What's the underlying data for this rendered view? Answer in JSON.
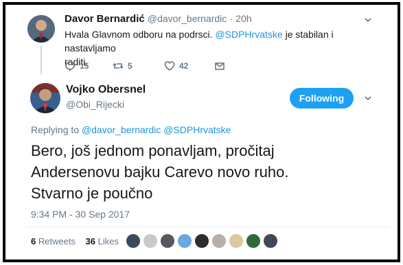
{
  "reply_to_tweet": {
    "display_name": "Davor Bernardić",
    "handle": "@davor_bernardic",
    "separator": "·",
    "time": "20h",
    "text_before": "Hvala Glavnom odboru na podrsci. ",
    "mention": "@SDPHrvatske",
    "text_after": " je stabilan i nastavljamo",
    "text_line2": "raditi.",
    "replies": "15",
    "retweets": "5",
    "likes": "42"
  },
  "main_tweet": {
    "display_name": "Vojko Obersnel",
    "handle": "@Obi_Rijecki",
    "follow_label": "Following",
    "replying_prefix": "Replying to ",
    "replying_to_1": "@davor_bernardic",
    "replying_to_2": "@SDPHrvatske",
    "text_line1": "Bero, još jednom ponavljam, pročitaj",
    "text_line2": "Andersenovu bajku Carevo novo ruho.",
    "text_line3": "Stvarno je poučno",
    "timestamp": "9:34 PM - 30 Sep 2017",
    "retweet_count": "6",
    "retweet_label": "Retweets",
    "like_count": "36",
    "like_label": "Likes"
  },
  "likers": [
    {
      "name": "liker-avatar-1",
      "color": "#3b4a5a"
    },
    {
      "name": "liker-avatar-2",
      "color": "#c9c9c9"
    },
    {
      "name": "liker-avatar-3",
      "color": "#55585c"
    },
    {
      "name": "liker-avatar-4",
      "color": "#6aa8e0"
    },
    {
      "name": "liker-avatar-5",
      "color": "#2d2d2d"
    },
    {
      "name": "liker-avatar-6",
      "color": "#b8b0a8"
    },
    {
      "name": "liker-avatar-7",
      "color": "#d9c8a0"
    },
    {
      "name": "liker-avatar-8",
      "color": "#2f6b3a"
    },
    {
      "name": "liker-avatar-9",
      "color": "#404a55"
    }
  ],
  "colors": {
    "link": "#1b95e0",
    "follow_button": "#1da1f2",
    "secondary_text": "#657786"
  }
}
